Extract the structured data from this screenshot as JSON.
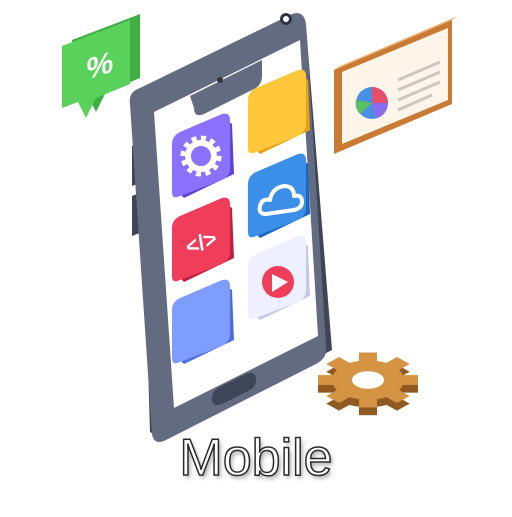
{
  "caption": "Mobile",
  "icons": [
    "percent-bubble-icon",
    "smartphone-icon",
    "settings-gear-app-icon",
    "code-app-icon",
    "cloud-app-icon",
    "play-video-app-icon",
    "pie-chart-card-icon",
    "gear-icon"
  ],
  "colors": {
    "phone_body": "#5b6478",
    "phone_screen": "#ffffff",
    "tile_purple": "#8a72ff",
    "tile_yellow": "#ffc83a",
    "tile_blue": "#3c8fe8",
    "tile_red": "#ef3d5a",
    "tile_video": "#eef0ff",
    "tile_periwinkle": "#7f9cff",
    "bubble_green": "#53cf52",
    "card_orange": "#e59a4e",
    "gear_bronze": "#c8883a"
  },
  "symbols": {
    "percent": "%",
    "code": "</>"
  }
}
